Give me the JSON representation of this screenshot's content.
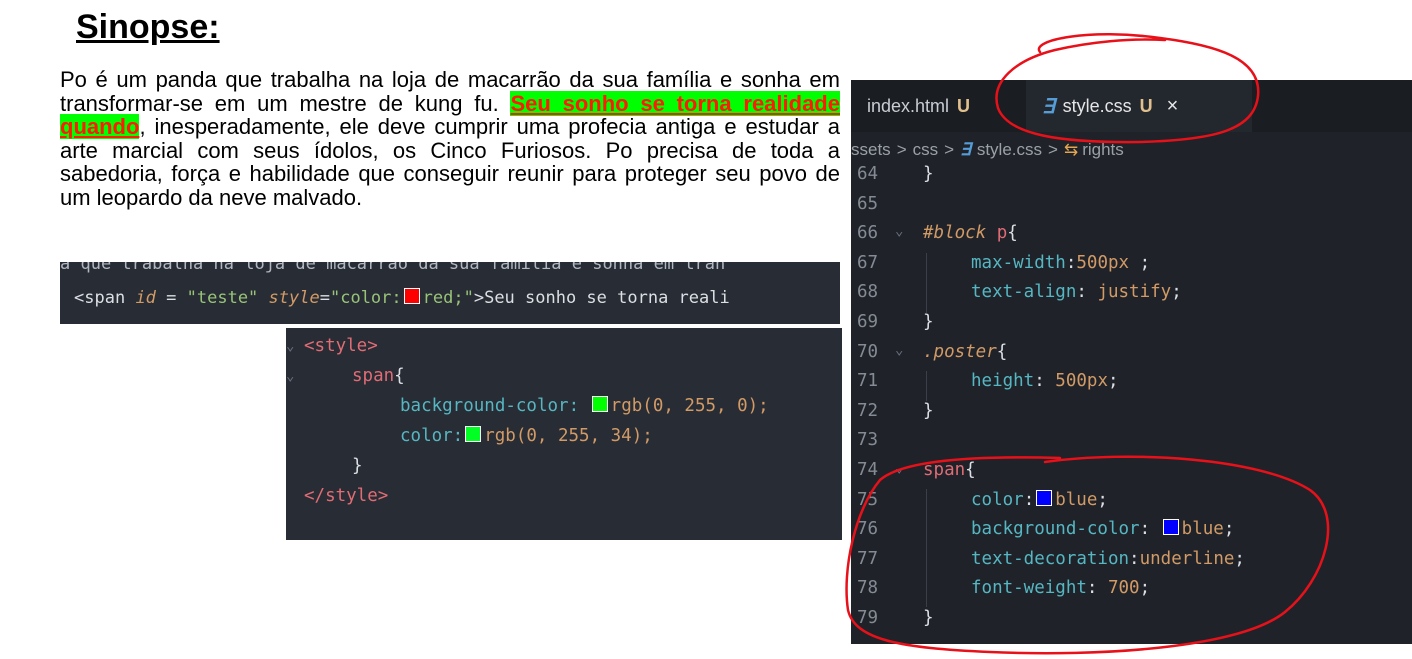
{
  "document": {
    "title": "Sinopse:",
    "paragraph_before": "Po é um panda que trabalha na loja de macarrão da sua família e sonha em transformar-se em um mestre de kung fu. ",
    "paragraph_highlight": "Seu sonho se torna realidade quando",
    "paragraph_after": ", inesperadamente, ele deve cumprir uma profecia antiga e estudar a arte marcial com seus ídolos, os Cinco Furiosos. Po precisa de toda a sabedoria, força e habilidade que conseguir reunir para proteger seu povo de um leopardo da neve malvado."
  },
  "snippet_span": {
    "ghost_line": "a que trabalha na loja de macarrão da sua família e sonha em tran",
    "open": "<span",
    "attr_id": "id",
    "eq": " = ",
    "id_value": "\"teste\"",
    "attr_style": "style",
    "style_eq": "=",
    "style_open": "\"color:",
    "style_value": "red;\"",
    "close": ">",
    "content": "Seu sonho se torna reali",
    "ghost_line_below": "  ",
    "swatch_color": "#ff0000"
  },
  "snippet_style": {
    "open_tag": "<style>",
    "selector": "span",
    "brace_open": "{",
    "prop1": "background-color:",
    "val1": "rgb(0, 255, 0);",
    "prop2": "color:",
    "val2": "rgb(0, 255, 34);",
    "brace_close": "}",
    "close_tag": "</style>",
    "swatch1": "#00ff00",
    "swatch2": "#00ff22"
  },
  "editor": {
    "tabs": {
      "index": {
        "label": "index.html",
        "status": "U"
      },
      "style": {
        "label": "style.css",
        "status": "U",
        "close": "×"
      }
    },
    "breadcrumb": {
      "part1": "ssets",
      "sep": ">",
      "part2": "css",
      "part3": "style.css",
      "part4": "rights"
    },
    "lines": {
      "l64": {
        "num": "64",
        "text": "}"
      },
      "l65": {
        "num": "65"
      },
      "l66": {
        "num": "66",
        "sel_id": "#block",
        "sel_tag": " p",
        "brace": "{"
      },
      "l67": {
        "num": "67",
        "prop": "max-width",
        "colon": ":",
        "val": "500px",
        "end": " ;"
      },
      "l68": {
        "num": "68",
        "prop": "text-align",
        "colon": ": ",
        "val": "justify",
        "end": ";"
      },
      "l69": {
        "num": "69",
        "text": "}"
      },
      "l70": {
        "num": "70",
        "sel_class": ".poster",
        "brace": "{"
      },
      "l71": {
        "num": "71",
        "prop": "height",
        "colon": ": ",
        "val": "500px",
        "end": ";"
      },
      "l72": {
        "num": "72",
        "text": "}"
      },
      "l73": {
        "num": "73"
      },
      "l74": {
        "num": "74",
        "sel_tag": "span",
        "brace": "{"
      },
      "l75": {
        "num": "75",
        "prop": "color",
        "colon": ":",
        "val": "blue",
        "end": ";",
        "swatch": "#0000ff"
      },
      "l76": {
        "num": "76",
        "prop": "background-color",
        "colon": ": ",
        "val": "blue",
        "end": ";",
        "swatch": "#0000ff"
      },
      "l77": {
        "num": "77",
        "prop": "text-decoration",
        "colon": ":",
        "val": "underline",
        "end": ";"
      },
      "l78": {
        "num": "78",
        "prop": "font-weight",
        "colon": ": ",
        "val": "700",
        "end": ";"
      },
      "l79": {
        "num": "79",
        "text": "}"
      }
    }
  },
  "annotation_color": "#e8111a"
}
